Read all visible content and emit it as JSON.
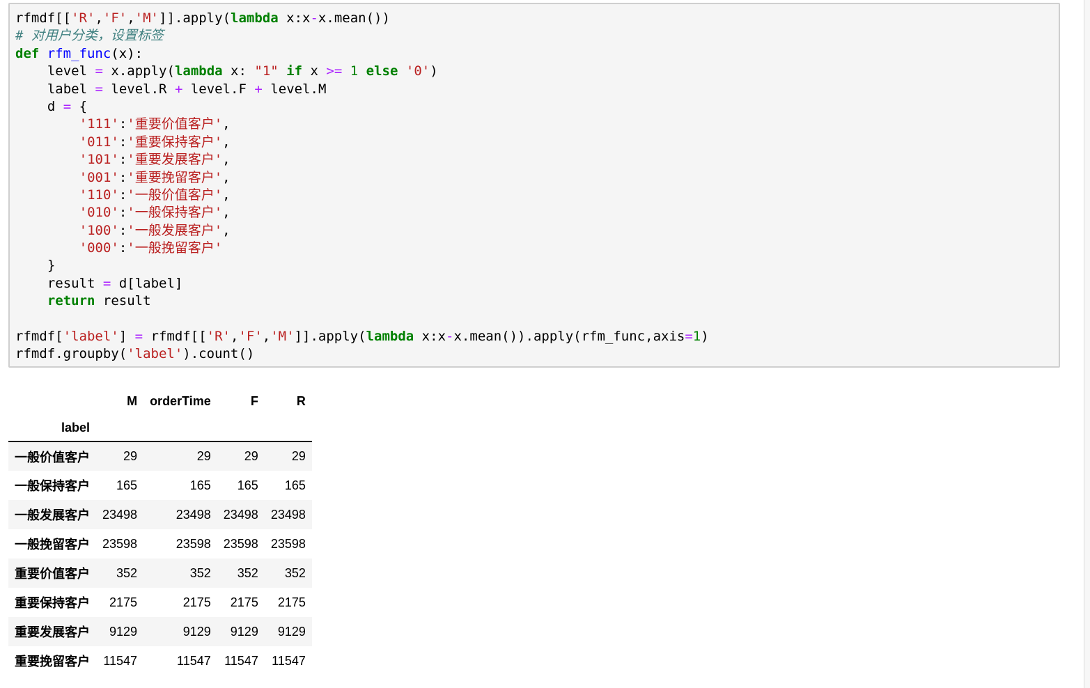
{
  "code_cell": {
    "lines": [
      "rfmdf[['R','F','M']].apply(lambda x:x-x.mean())",
      "# 对用户分类，设置标签",
      "def rfm_func(x):",
      "    level = x.apply(lambda x: \"1\" if x >= 1 else '0')",
      "    label = level.R + level.F + level.M",
      "    d = {",
      "        '111':'重要价值客户',",
      "        '011':'重要保持客户',",
      "        '101':'重要发展客户',",
      "        '001':'重要挽留客户',",
      "        '110':'一般价值客户',",
      "        '010':'一般保持客户',",
      "        '100':'一般发展客户',",
      "        '000':'一般挽留客户'",
      "    }",
      "    result = d[label]",
      "    return result",
      "",
      "rfmdf['label'] = rfmdf[['R','F','M']].apply(lambda x:x-x.mean()).apply(rfm_func,axis=1)",
      "rfmdf.groupby('label').count()"
    ]
  },
  "output_table": {
    "columns": [
      "M",
      "orderTime",
      "F",
      "R"
    ],
    "index_name": "label",
    "rows": [
      {
        "label": "一般价值客户",
        "values": [
          "29",
          "29",
          "29",
          "29"
        ]
      },
      {
        "label": "一般保持客户",
        "values": [
          "165",
          "165",
          "165",
          "165"
        ]
      },
      {
        "label": "一般发展客户",
        "values": [
          "23498",
          "23498",
          "23498",
          "23498"
        ]
      },
      {
        "label": "一般挽留客户",
        "values": [
          "23598",
          "23598",
          "23598",
          "23598"
        ]
      },
      {
        "label": "重要价值客户",
        "values": [
          "352",
          "352",
          "352",
          "352"
        ]
      },
      {
        "label": "重要保持客户",
        "values": [
          "2175",
          "2175",
          "2175",
          "2175"
        ]
      },
      {
        "label": "重要发展客户",
        "values": [
          "9129",
          "9129",
          "9129",
          "9129"
        ]
      },
      {
        "label": "重要挽留客户",
        "values": [
          "11547",
          "11547",
          "11547",
          "11547"
        ]
      }
    ]
  },
  "colors": {
    "keyword": "#008000",
    "string": "#ba2121",
    "operator": "#aa22ff",
    "function_name": "#0000ff",
    "comment": "#408080",
    "cell_background": "#f5f5f5",
    "cell_border": "#cfcfcf"
  }
}
